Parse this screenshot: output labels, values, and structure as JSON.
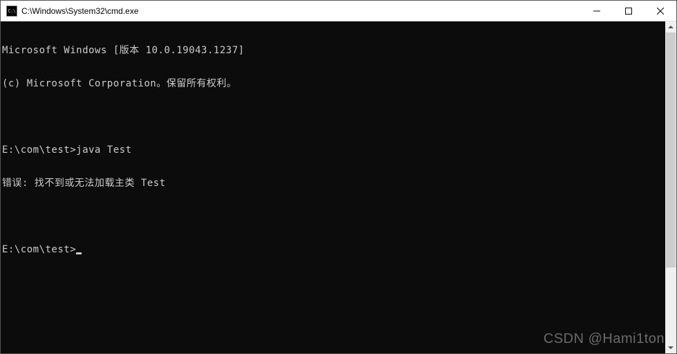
{
  "titlebar": {
    "title": "C:\\Windows\\System32\\cmd.exe"
  },
  "terminal": {
    "lines": [
      "Microsoft Windows [版本 10.0.19043.1237]",
      "(c) Microsoft Corporation。保留所有权利。",
      "",
      "E:\\com\\test>java Test",
      "错误: 找不到或无法加载主类 Test",
      "",
      "E:\\com\\test>"
    ],
    "prompt_prefix": "E:\\com\\test>",
    "last_command": "java Test",
    "error_message": "错误: 找不到或无法加载主类 Test"
  },
  "watermark": "CSDN @Hami1ton"
}
